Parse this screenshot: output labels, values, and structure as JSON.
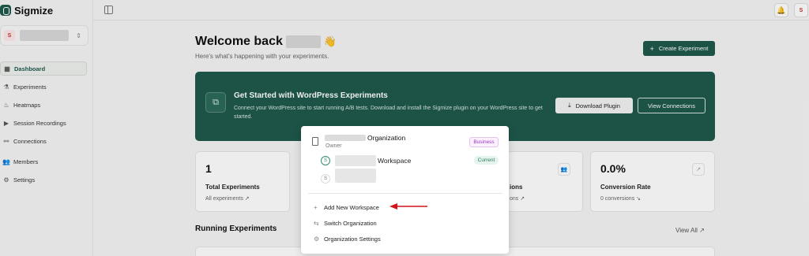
{
  "brand": {
    "name": "Sigmize"
  },
  "workspace_switcher": {
    "avatar_letter": "S"
  },
  "sidebar": {
    "items": [
      {
        "label": "Dashboard",
        "icon": "grid-icon",
        "glyph": "▦",
        "active": true
      },
      {
        "label": "Experiments",
        "icon": "flask-icon",
        "glyph": "⚗",
        "active": false
      },
      {
        "label": "Heatmaps",
        "icon": "flame-icon",
        "glyph": "♨",
        "active": false
      },
      {
        "label": "Session Recordings",
        "icon": "video-icon",
        "glyph": "▶",
        "active": false
      },
      {
        "label": "Connections",
        "icon": "plug-icon",
        "glyph": "⚯",
        "active": false
      },
      {
        "label": "Members",
        "icon": "users-icon",
        "glyph": "👥",
        "active": false
      },
      {
        "label": "Settings",
        "icon": "gear-icon",
        "glyph": "⚙",
        "active": false
      }
    ]
  },
  "topbar": {
    "avatar_letter": "S"
  },
  "main": {
    "welcome": "Welcome back",
    "wave": "👋",
    "subtitle": "Here's what's happening with your experiments.",
    "create_button": "Create Experiment"
  },
  "banner": {
    "title": "Get Started with WordPress Experiments",
    "description": "Connect your WordPress site to start running A/B tests. Download and install the Sigmize plugin on your WordPress site to get started.",
    "download_button": "Download Plugin",
    "view_button": "View Connections"
  },
  "stats": [
    {
      "value": "1",
      "label": "Total Experiments",
      "sub": "All experiments ↗"
    },
    {
      "label_fragment": "ions",
      "sub_fragment": "ons ↗"
    },
    {
      "value": "0.0%",
      "label": "Conversion Rate",
      "sub": "0 conversions ↘"
    }
  ],
  "running": {
    "title": "Running Experiments",
    "view_all": "View All ↗"
  },
  "popup": {
    "org_name": "Organization",
    "org_role": "Owner",
    "plan_badge": "Business",
    "workspace_label": "Workspace",
    "current_badge": "Current",
    "workspace_letter": "S",
    "menu": [
      {
        "label": "Add New Workspace",
        "icon": "plus-icon",
        "glyph": "+"
      },
      {
        "label": "Switch Organization",
        "icon": "switch-icon",
        "glyph": "⇆"
      },
      {
        "label": "Organization Settings",
        "icon": "gear-icon",
        "glyph": "⚙"
      }
    ]
  },
  "colors": {
    "brand": "#1f5a4c",
    "annotation_arrow": "#d0161b"
  }
}
